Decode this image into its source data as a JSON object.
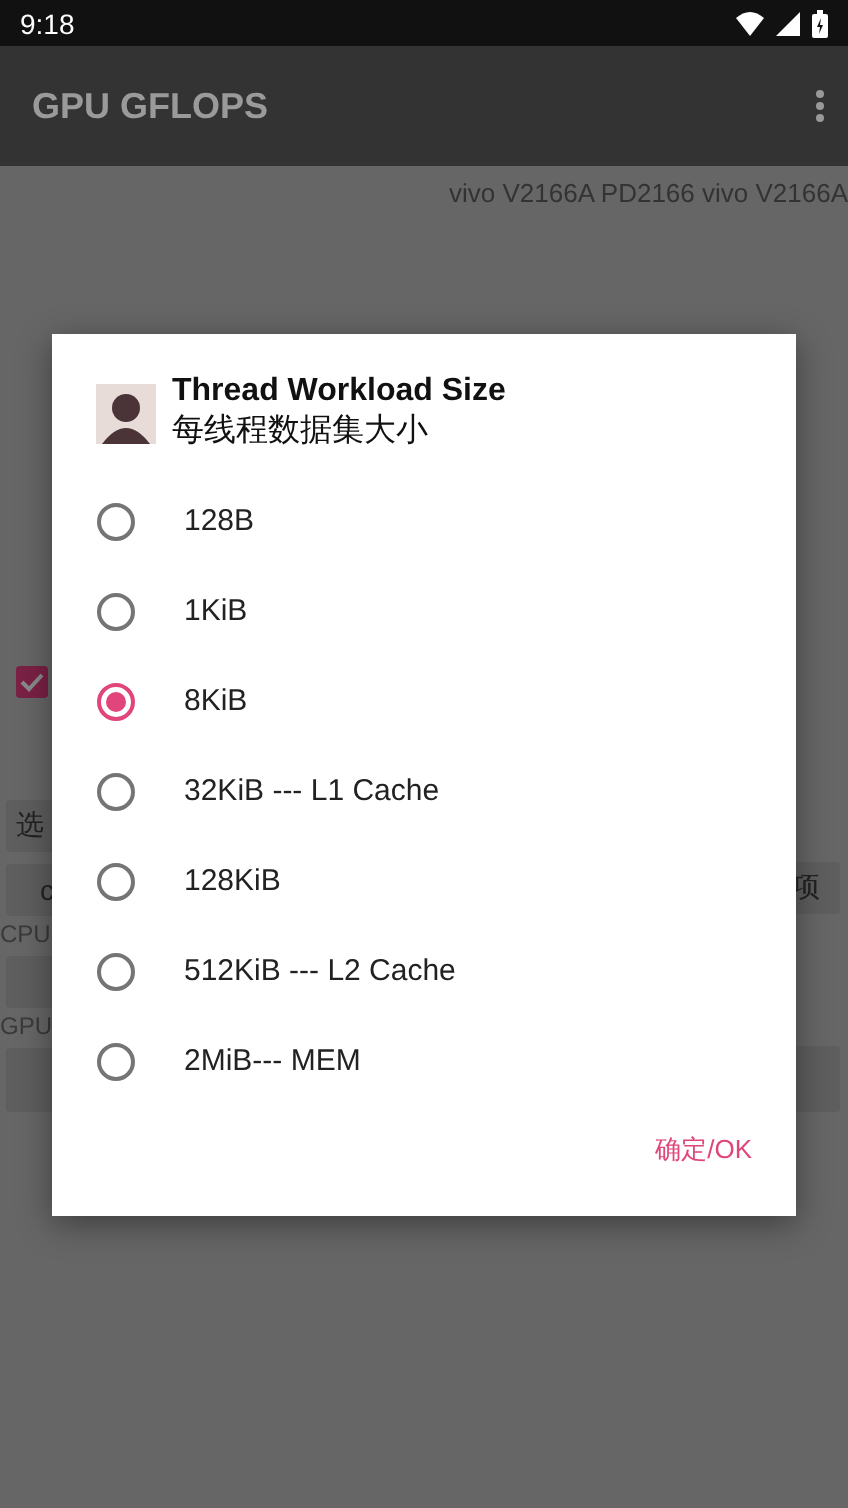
{
  "status_bar": {
    "time": "9:18"
  },
  "app_bar": {
    "title": "GPU GFLOPS"
  },
  "background": {
    "device_info": "vivo V2166A PD2166 vivo V2166A",
    "checkbox": {
      "checked": true
    },
    "select_button": "选",
    "button_left": "c",
    "button_right": "项",
    "cpu_label": "CPU",
    "gpu_label": "GPU"
  },
  "dialog": {
    "title": "Thread Workload Size",
    "subtitle": "每线程数据集大小",
    "options": [
      {
        "label": "128B",
        "selected": false
      },
      {
        "label": "1KiB",
        "selected": false
      },
      {
        "label": "8KiB",
        "selected": true
      },
      {
        "label": "32KiB --- L1 Cache",
        "selected": false
      },
      {
        "label": "128KiB",
        "selected": false
      },
      {
        "label": "512KiB --- L2 Cache",
        "selected": false
      },
      {
        "label": "2MiB--- MEM",
        "selected": false
      }
    ],
    "ok_button": "确定/OK"
  }
}
